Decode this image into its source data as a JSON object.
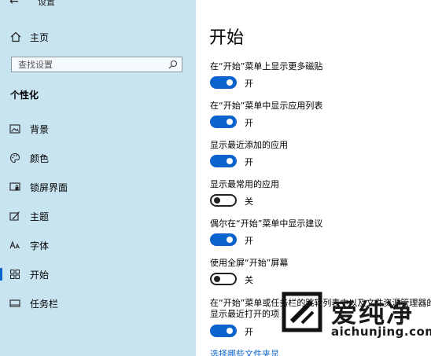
{
  "app": {
    "title": "设置"
  },
  "sidebar": {
    "home_label": "主页",
    "search_placeholder": "查找设置",
    "section_heading": "个性化",
    "items": [
      {
        "label": "背景",
        "icon": "image-icon"
      },
      {
        "label": "颜色",
        "icon": "palette-icon"
      },
      {
        "label": "锁屏界面",
        "icon": "lock-screen-icon"
      },
      {
        "label": "主题",
        "icon": "theme-icon"
      },
      {
        "label": "字体",
        "icon": "font-icon"
      },
      {
        "label": "开始",
        "icon": "start-icon",
        "selected": true
      },
      {
        "label": "任务栏",
        "icon": "taskbar-icon"
      }
    ]
  },
  "main": {
    "title": "开始",
    "settings": [
      {
        "label": "在“开始”菜单上显示更多磁贴",
        "on": true,
        "state_label": "开"
      },
      {
        "label": "在“开始”菜单中显示应用列表",
        "on": true,
        "state_label": "开"
      },
      {
        "label": "显示最近添加的应用",
        "on": true,
        "state_label": "开"
      },
      {
        "label": "显示最常用的应用",
        "on": false,
        "state_label": "关"
      },
      {
        "label": "偶尔在“开始”菜单中显示建议",
        "on": true,
        "state_label": "开"
      },
      {
        "label": "使用全屏“开始”屏幕",
        "on": false,
        "state_label": "关"
      },
      {
        "label": "在“开始”菜单或任务栏的跳转列表中以及文件资源管理器的“",
        "label_line2": "显示最近打开的项",
        "on": true,
        "state_label": "开"
      }
    ],
    "link": "选择哪些文件夹显"
  },
  "colors": {
    "accent": "#0b63ce",
    "sidebar_bg": "#c9e4f1"
  },
  "watermark": {
    "text": "爱纯净",
    "url": "aichunjing.com"
  }
}
